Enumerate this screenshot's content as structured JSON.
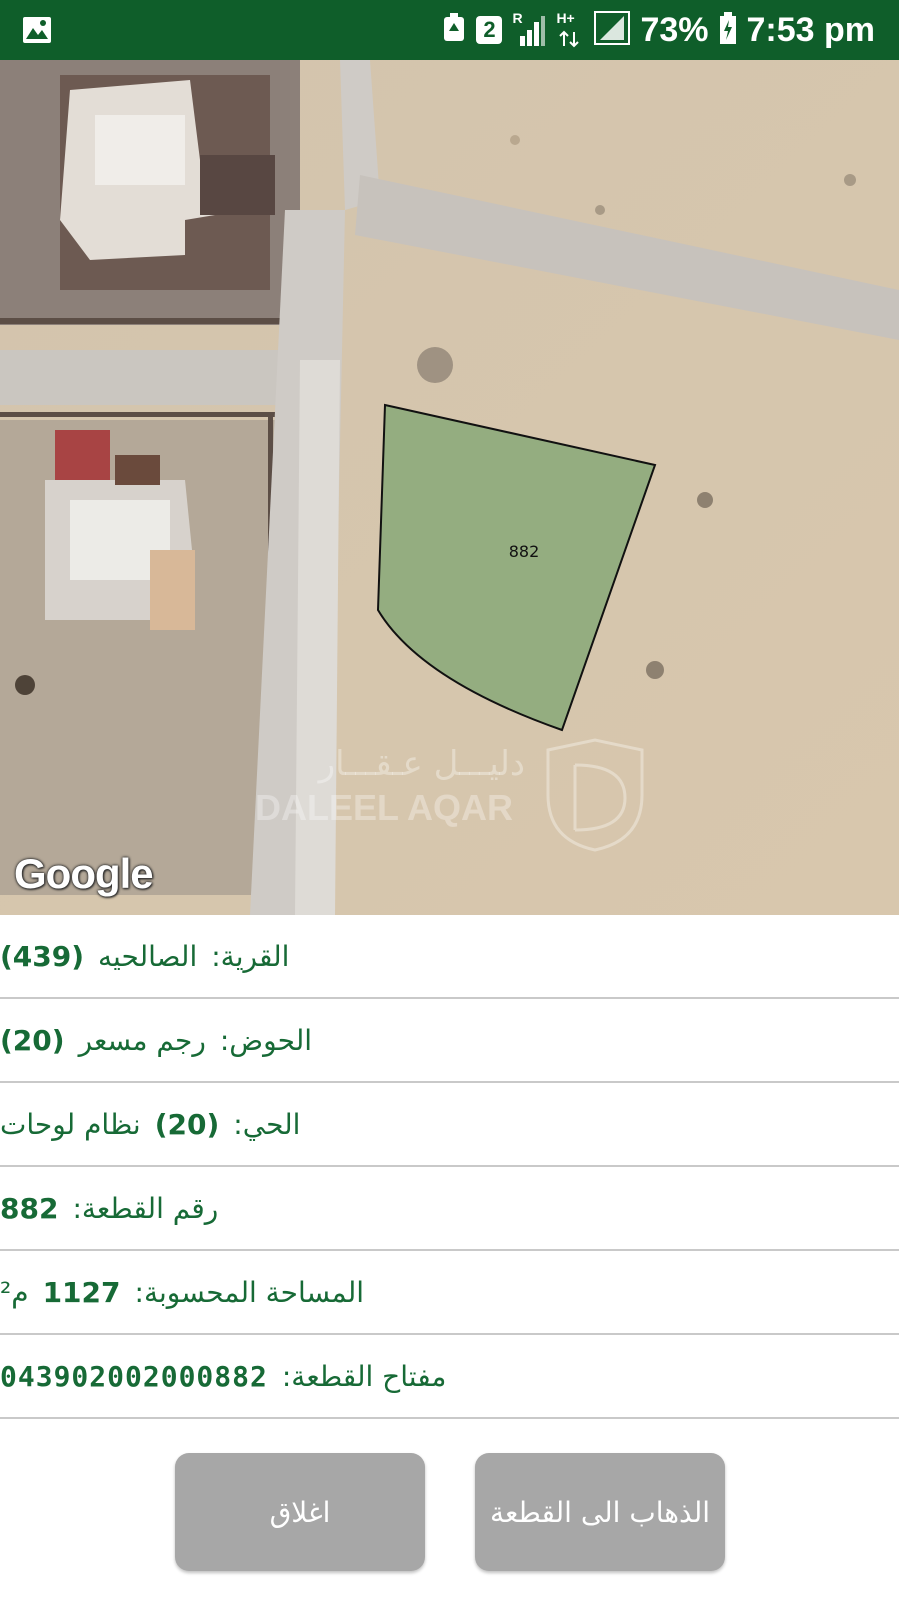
{
  "status_bar": {
    "time": "7:53 pm",
    "battery_percent": "73%",
    "sim_slot": "2",
    "roaming": "R",
    "network_type": "H+",
    "icons": [
      "image-icon",
      "recycle-icon",
      "sim-2-icon",
      "signal-icon",
      "network-icon",
      "signal-icon",
      "battery-charging-icon"
    ]
  },
  "map": {
    "parcel_label": "882",
    "watermark_ar": "دليـــل عـقـــار",
    "watermark_en": "DALEEL AQAR",
    "provider_logo": "Google"
  },
  "info": {
    "village": {
      "label": "القرية:",
      "name": "الصالحيه",
      "code": "(439)"
    },
    "basin": {
      "label": "الحوض:",
      "name": "رجم مسعر",
      "code": "(20)"
    },
    "neighborhood": {
      "label": "الحي:",
      "code": "(20)",
      "name": "نظام لوحات"
    },
    "parcel_number": {
      "label": "رقم القطعة:",
      "value": "882"
    },
    "area": {
      "label": "المساحة المحسوبة:",
      "value": "1127",
      "unit": "م²"
    },
    "parcel_key": {
      "label": "مفتاح القطعة:",
      "value": "043902002000882"
    }
  },
  "buttons": {
    "close": "اغلاق",
    "go_to_parcel": "الذهاب الى القطعة"
  },
  "colors": {
    "status_bar": "#0f5e2a",
    "text_green": "#176a36",
    "parcel_fill": "#88a878",
    "button_gray": "#a7a7a7"
  }
}
